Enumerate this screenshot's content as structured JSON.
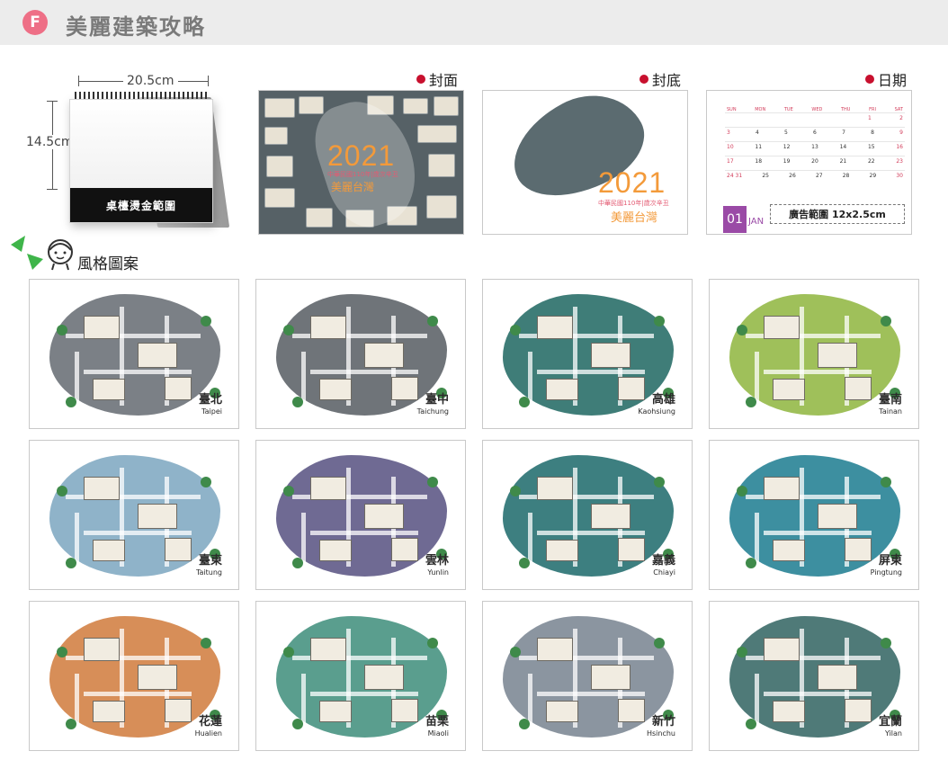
{
  "header": {
    "badge": "F",
    "title": "美麗建築攻略"
  },
  "desk_calendar": {
    "width_label": "20.5cm",
    "height_label": "14.5cm",
    "imprint_label": "桌檯燙金範圍"
  },
  "previews": {
    "front": {
      "label": "封面",
      "year": "2021",
      "subtitle": "中華民國110年|歲次辛丑",
      "name": "美麗台灣"
    },
    "back": {
      "label": "封底",
      "year": "2021",
      "subtitle": "中華民國110年|歲次辛丑",
      "name": "美麗台灣"
    },
    "date": {
      "label": "日期",
      "weekdays": [
        "SUN",
        "MON",
        "TUE",
        "WED",
        "THU",
        "FRI",
        "SAT"
      ],
      "weeks": [
        [
          "",
          "",
          "",
          "",
          "",
          "1",
          "2"
        ],
        [
          "3",
          "4",
          "5",
          "6",
          "7",
          "8",
          "9"
        ],
        [
          "10",
          "11",
          "12",
          "13",
          "14",
          "15",
          "16"
        ],
        [
          "17",
          "18",
          "19",
          "20",
          "21",
          "22",
          "23"
        ],
        [
          "24 31",
          "25",
          "26",
          "27",
          "28",
          "29",
          "30"
        ]
      ],
      "month_number": "01",
      "month_name": "JAN",
      "ad_label": "廣告範圍 12x2.5cm"
    }
  },
  "style_section": {
    "label": "風格圖案"
  },
  "maps": [
    {
      "city": "臺北",
      "english": "Taipei",
      "color": "#7b8086"
    },
    {
      "city": "臺中",
      "english": "Taichung",
      "color": "#6f7479"
    },
    {
      "city": "高雄",
      "english": "Kaohsiung",
      "color": "#3f7d78"
    },
    {
      "city": "臺南",
      "english": "Tainan",
      "color": "#9fc05a"
    },
    {
      "city": "臺東",
      "english": "Taitung",
      "color": "#8fb3c9"
    },
    {
      "city": "雲林",
      "english": "Yunlin",
      "color": "#6f6a93"
    },
    {
      "city": "嘉義",
      "english": "Chiayi",
      "color": "#3d7f80"
    },
    {
      "city": "屏東",
      "english": "Pingtung",
      "color": "#3d8fa0"
    },
    {
      "city": "花蓮",
      "english": "Hualien",
      "color": "#d78e58"
    },
    {
      "city": "苗栗",
      "english": "Miaoli",
      "color": "#5a9e8e"
    },
    {
      "city": "新竹",
      "english": "Hsinchu",
      "color": "#8b95a0"
    },
    {
      "city": "宜蘭",
      "english": "Yilan",
      "color": "#4f7a78"
    }
  ]
}
